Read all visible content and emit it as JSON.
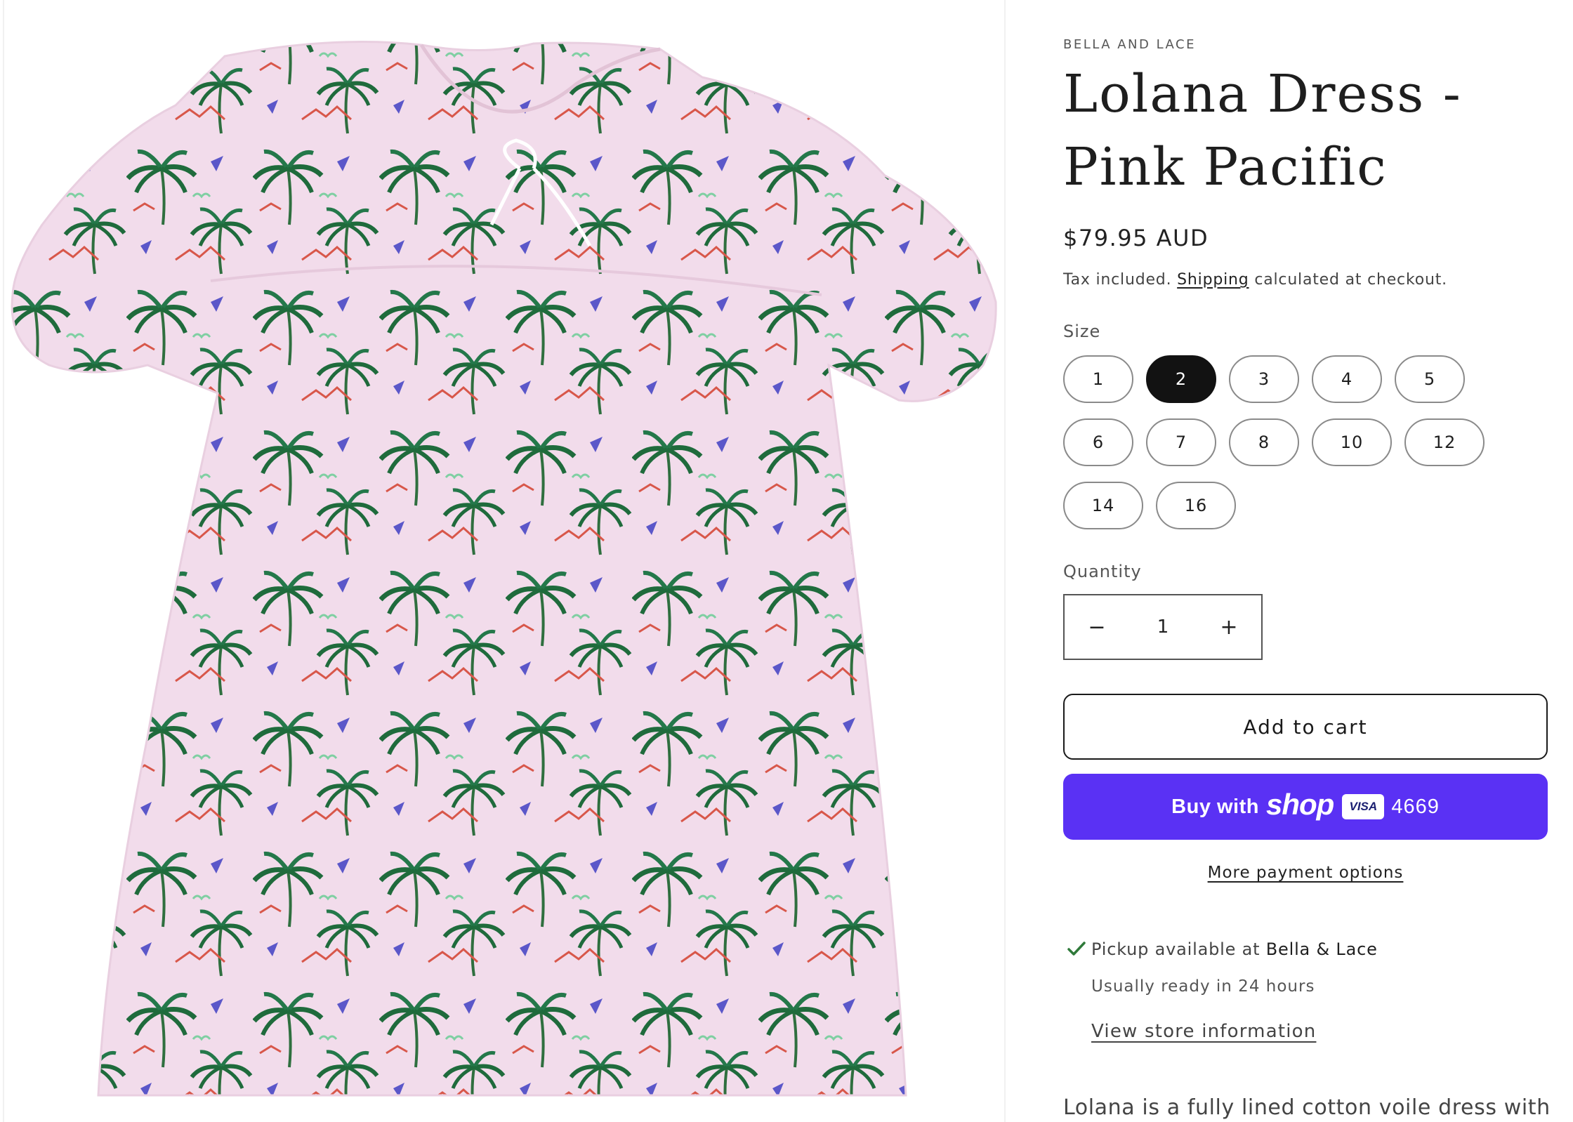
{
  "product": {
    "vendor": "BELLA AND LACE",
    "title": "Lolana Dress - Pink Pacific",
    "price": "$79.95 AUD",
    "tax_prefix": "Tax included.",
    "shipping_link": "Shipping",
    "tax_suffix": "calculated at checkout.",
    "image_alt": "Lolana Dress - Pink Pacific, pink dress with green palm tree print"
  },
  "size": {
    "label": "Size",
    "selected": "2",
    "options": [
      "1",
      "2",
      "3",
      "4",
      "5",
      "6",
      "7",
      "8",
      "10",
      "12",
      "14",
      "16"
    ]
  },
  "quantity": {
    "label": "Quantity",
    "value": "1",
    "minus": "−",
    "plus": "+"
  },
  "buttons": {
    "add_to_cart": "Add to cart",
    "shop_pay_prefix": "Buy with",
    "shop_pay_brand": "shop",
    "shop_pay_card": "VISA",
    "shop_pay_digits": "4669",
    "more_payment_options": "More payment options"
  },
  "pickup": {
    "available_prefix": "Pickup available at",
    "store_name": "Bella & Lace",
    "ready_time": "Usually ready in 24 hours",
    "store_link": "View store information"
  },
  "description": {
    "first_line": "Lolana is a fully lined cotton voile dress with"
  },
  "colors": {
    "accent_shop_pay": "#5a31f4",
    "selected_pill": "#121212",
    "dress_pink": "#f3dcea",
    "palm_green": "#1f6b3c"
  }
}
